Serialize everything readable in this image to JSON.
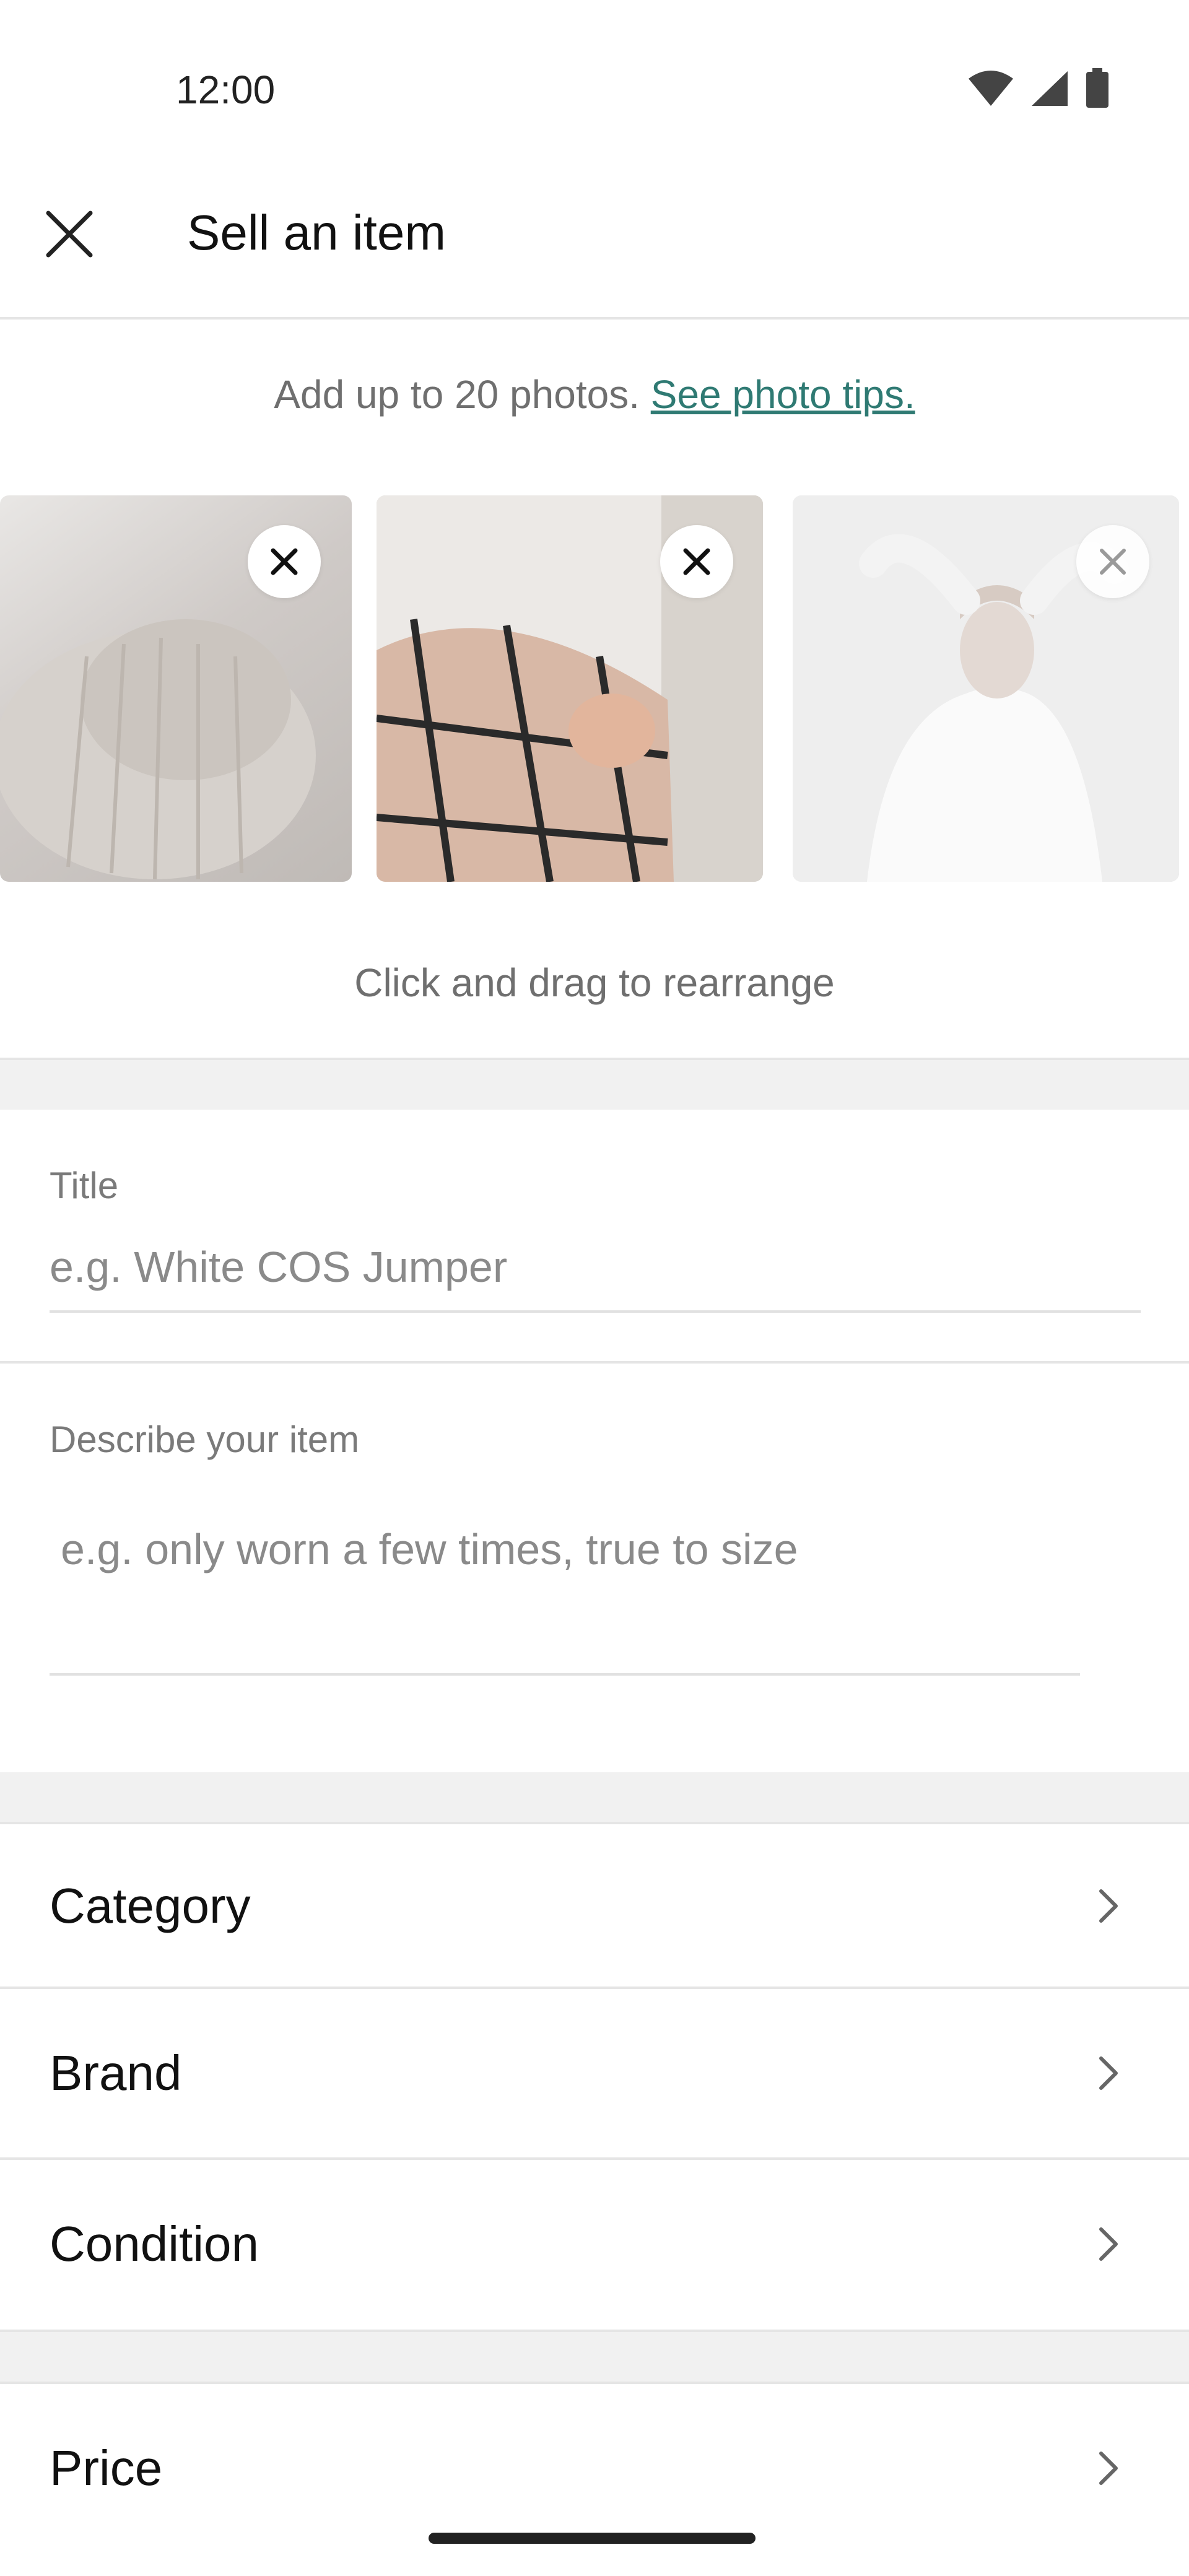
{
  "status_bar": {
    "time": "12:00",
    "icons": [
      "wifi-icon",
      "cellular-signal-icon",
      "battery-icon"
    ]
  },
  "header": {
    "title": "Sell an item",
    "close_icon": "close-icon"
  },
  "photos": {
    "hint_text": "Add up to 20 photos. ",
    "tips_link": "See photo tips.",
    "rearrange_text": "Click and drag to rearrange",
    "items": [
      {
        "name": "knit-sweater-photo",
        "remove_icon": "close-icon"
      },
      {
        "name": "white-top-checked-scarf-photo",
        "remove_icon": "close-icon"
      },
      {
        "name": "white-turtleneck-photo",
        "remove_icon": "close-icon"
      }
    ]
  },
  "form": {
    "title_label": "Title",
    "title_placeholder": "e.g. White COS Jumper",
    "description_label": "Describe your item",
    "description_placeholder": "e.g. only worn a few times, true to size"
  },
  "options": [
    {
      "label": "Category",
      "icon": "chevron-right-icon"
    },
    {
      "label": "Brand",
      "icon": "chevron-right-icon"
    },
    {
      "label": "Condition",
      "icon": "chevron-right-icon"
    },
    {
      "label": "Price",
      "icon": "chevron-right-icon"
    }
  ],
  "colors": {
    "link": "#2f7a73",
    "separator": "#f1f1f1",
    "muted_text": "#6f6f6f"
  }
}
